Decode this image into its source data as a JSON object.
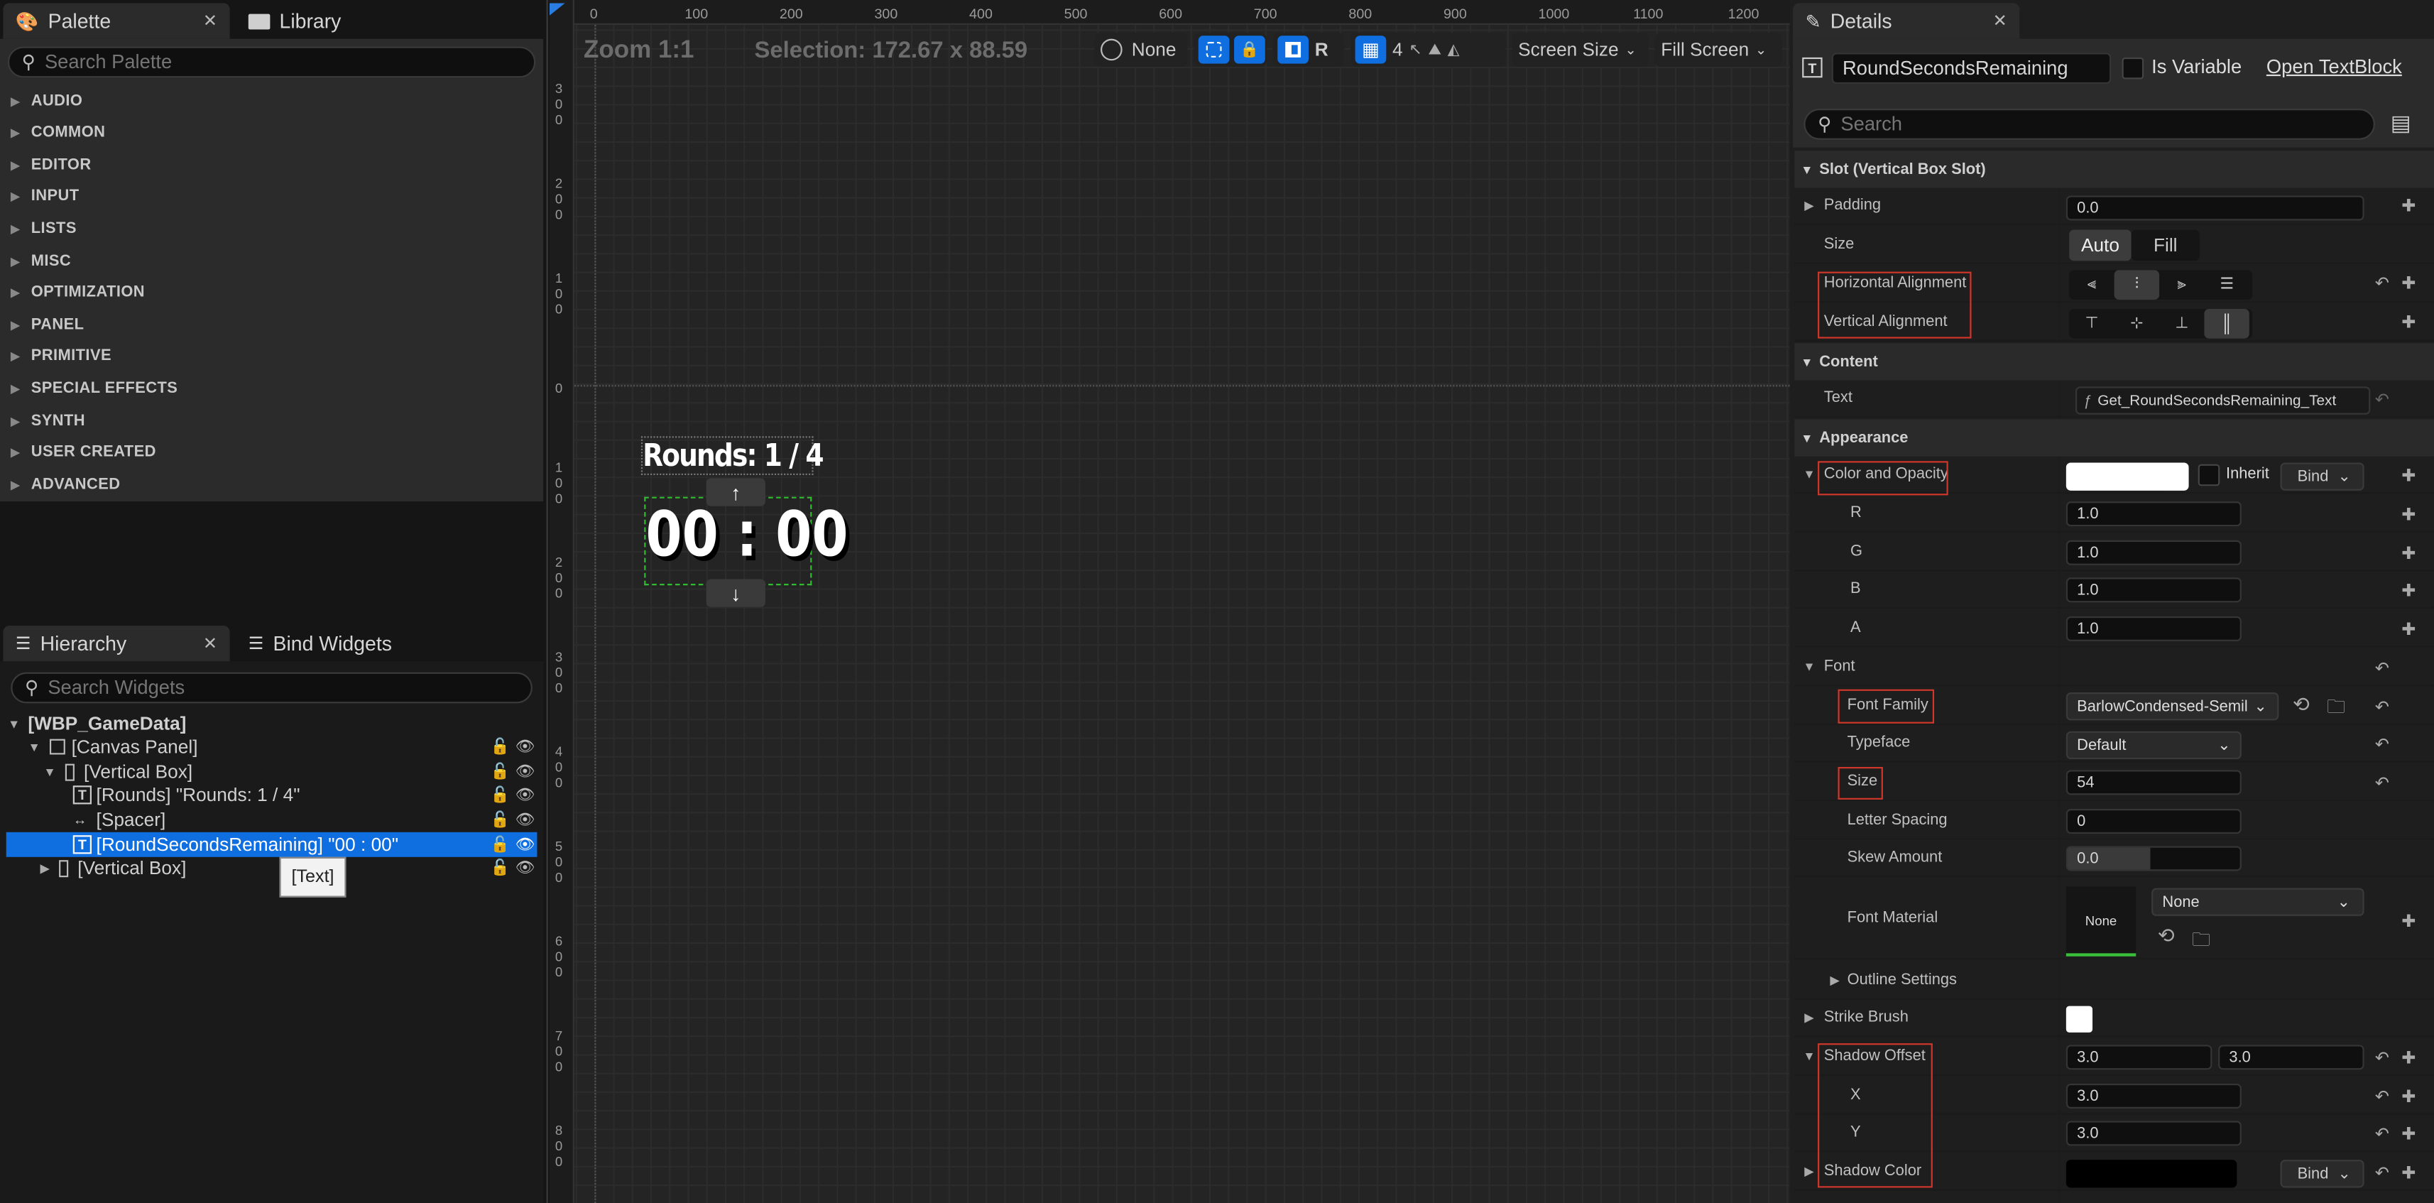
{
  "palette_panel": {
    "tab_palette": "Palette",
    "tab_library": "Library",
    "search_placeholder": "Search Palette",
    "categories": [
      "AUDIO",
      "COMMON",
      "EDITOR",
      "INPUT",
      "LISTS",
      "MISC",
      "OPTIMIZATION",
      "PANEL",
      "PRIMITIVE",
      "SPECIAL EFFECTS",
      "SYNTH",
      "USER CREATED",
      "ADVANCED"
    ]
  },
  "hierarchy_panel": {
    "tab_hierarchy": "Hierarchy",
    "tab_bind": "Bind Widgets",
    "search_placeholder": "Search Widgets",
    "rows": [
      {
        "label": "[WBP_GameData]"
      },
      {
        "label": "[Canvas Panel]"
      },
      {
        "label": "[Vertical Box]"
      },
      {
        "label": "[Rounds] \"Rounds: 1 / 4\""
      },
      {
        "label": "[Spacer]"
      },
      {
        "label": "[RoundSecondsRemaining] \"00 : 00\""
      },
      {
        "label": "[Vertical Box]"
      }
    ],
    "tooltip": "[Text]"
  },
  "viewport": {
    "zoom": "Zoom 1:1",
    "selection": "Selection: 172.67 x 88.59",
    "none_label": "None",
    "r_label": "R",
    "grid_value": "4",
    "screen_size": "Screen Size",
    "fill_screen": "Fill Screen",
    "ruler_h": [
      "0",
      "100",
      "200",
      "300",
      "400",
      "500",
      "600",
      "700",
      "800",
      "900",
      "1000",
      "1100",
      "1200"
    ],
    "ruler_v": [
      "300",
      "200",
      "100",
      "0",
      "100",
      "200",
      "300",
      "400",
      "500",
      "600",
      "700",
      "800"
    ],
    "rounds_text": "Rounds: 1 / 4",
    "timer_text": "00 : 00",
    "arrow_up": "↑",
    "arrow_down": "↓"
  },
  "details_panel": {
    "tab": "Details",
    "widget_name": "RoundSecondsRemaining",
    "is_variable": "Is Variable",
    "open_textblock": "Open TextBlock",
    "search_placeholder": "Search",
    "sections": {
      "slot": "Slot (Vertical Box Slot)",
      "content": "Content",
      "appearance": "Appearance"
    },
    "labels": {
      "padding": "Padding",
      "size": "Size",
      "h_align": "Horizontal Alignment",
      "v_align": "Vertical Alignment",
      "text": "Text",
      "color_opacity": "Color and Opacity",
      "r": "R",
      "g": "G",
      "b": "B",
      "a": "A",
      "font": "Font",
      "font_family": "Font Family",
      "typeface": "Typeface",
      "font_size": "Size",
      "letter_spacing": "Letter Spacing",
      "skew_amount": "Skew Amount",
      "font_material": "Font Material",
      "outline_settings": "Outline Settings",
      "strike_brush": "Strike Brush",
      "shadow_offset": "Shadow Offset",
      "x": "X",
      "y": "Y",
      "shadow_color": "Shadow Color"
    },
    "values": {
      "padding": "0.0",
      "size_auto": "Auto",
      "size_fill": "Fill",
      "text_binding": "Get_RoundSecondsRemaining_Text",
      "inherit": "Inherit",
      "bind": "Bind",
      "r": "1.0",
      "g": "1.0",
      "b": "1.0",
      "a": "1.0",
      "font_family": "BarlowCondensed-Semil",
      "typeface": "Default",
      "font_size": "54",
      "letter_spacing": "0",
      "skew_amount": "0.0",
      "material_swatch": "None",
      "material_select": "None",
      "shadow_offset_x": "3.0",
      "shadow_offset_y": "3.0",
      "x": "3.0",
      "y": "3.0"
    }
  }
}
